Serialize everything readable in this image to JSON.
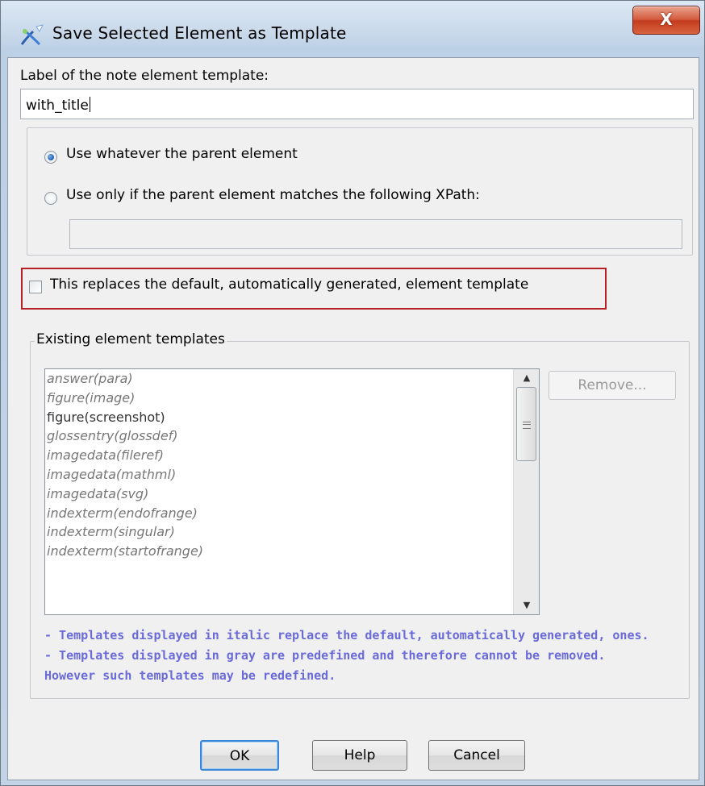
{
  "window": {
    "title": "Save Selected Element as Template",
    "close_glyph": "X"
  },
  "label_field": {
    "heading": "Label of the note element template:",
    "value": "with_title"
  },
  "scope": {
    "option_any": "Use whatever the parent element",
    "option_xpath": "Use only if the parent element matches the following XPath:",
    "selected": "option_any",
    "xpath_value": ""
  },
  "replace_default": {
    "label": "This replaces the default, automatically generated, element template",
    "checked": false
  },
  "existing": {
    "legend": "Existing element templates",
    "items": [
      {
        "text": "answer(para)",
        "style": "italic"
      },
      {
        "text": "figure(image)",
        "style": "italic"
      },
      {
        "text": "figure(screenshot)",
        "style": "normal"
      },
      {
        "text": "glossentry(glossdef)",
        "style": "italic"
      },
      {
        "text": "imagedata(fileref)",
        "style": "italic"
      },
      {
        "text": "imagedata(mathml)",
        "style": "italic"
      },
      {
        "text": "imagedata(svg)",
        "style": "italic"
      },
      {
        "text": "indexterm(endofrange)",
        "style": "italic"
      },
      {
        "text": "indexterm(singular)",
        "style": "italic"
      },
      {
        "text": "indexterm(startofrange)",
        "style": "italic"
      },
      {
        "text": "",
        "style": "italic"
      },
      {
        "text": "",
        "style": "italic"
      },
      {
        "text": "",
        "style": "italic"
      }
    ],
    "remove_label": "Remove..."
  },
  "notes": [
    "- Templates displayed in italic replace the default, automatically generated, ones.",
    "- Templates displayed in gray are predefined and therefore cannot be removed.",
    "However such templates may be redefined."
  ],
  "buttons": {
    "ok": "OK",
    "help": "Help",
    "cancel": "Cancel"
  },
  "colors": {
    "highlight_border": "#b61f24",
    "note_text": "#6a6ad8",
    "default_button_border": "#3b86d6"
  }
}
